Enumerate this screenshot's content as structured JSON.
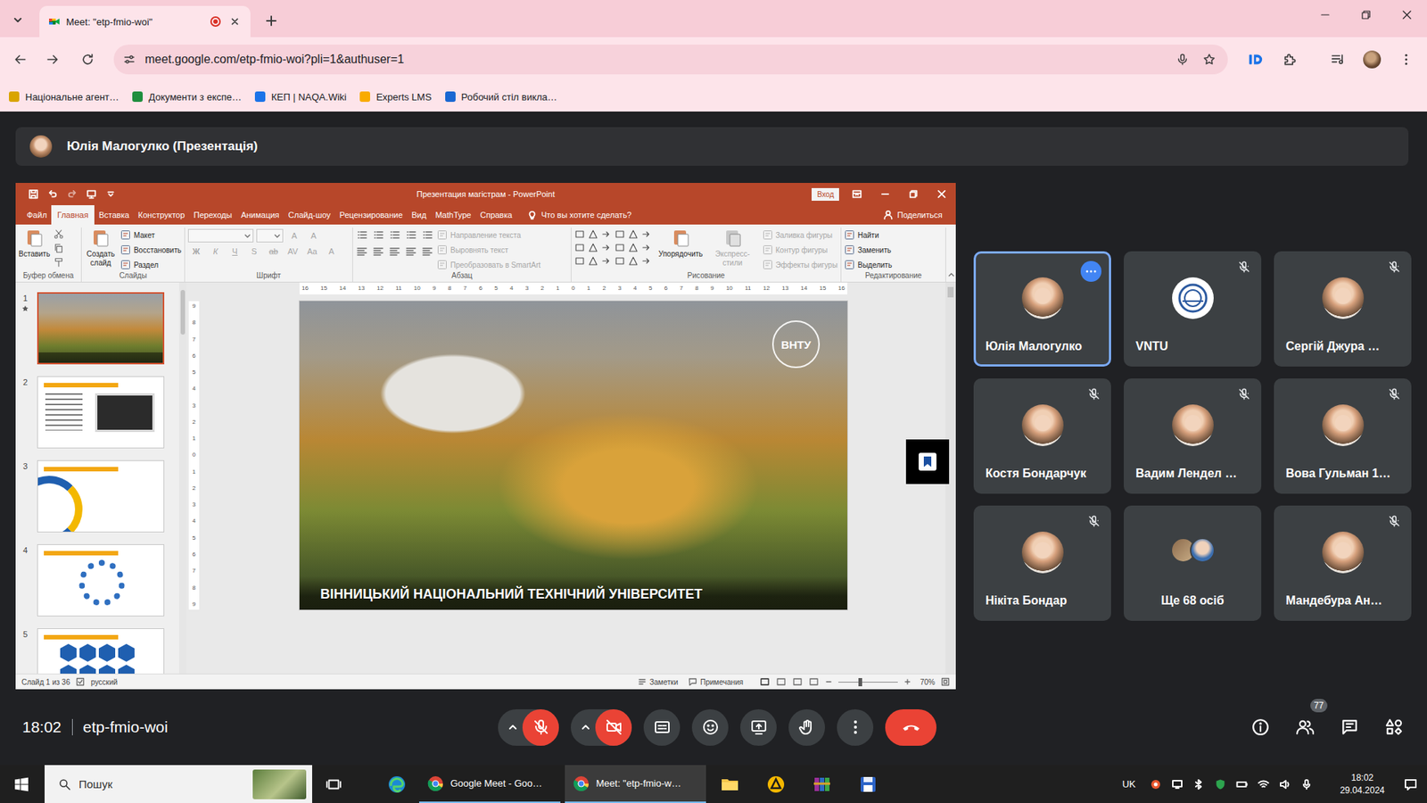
{
  "browser": {
    "tab": {
      "title": "Meet: \"etp-fmio-woi\"",
      "recording": true,
      "selected": true
    },
    "url": "meet.google.com/etp-fmio-woi?pli=1&authuser=1",
    "bookmarks": [
      {
        "label": "Національне агент…",
        "color": "#d9a400"
      },
      {
        "label": "Документи з експе…",
        "color": "#1e8e3e"
      },
      {
        "label": "КЕП | NAQA.Wiki",
        "color": "#1a73e8"
      },
      {
        "label": "Experts LMS",
        "color": "#f9ab00"
      },
      {
        "label": "Робочий стіл викла…",
        "color": "#1967d2"
      }
    ]
  },
  "meet": {
    "presenter": "Юлія Малогулко (Презентація)",
    "time": "18:02",
    "code": "etp-fmio-woi",
    "participants": [
      {
        "name": "Юлія Малогулко",
        "kind": "person",
        "muted": false,
        "highlighted": true,
        "options": true
      },
      {
        "name": "VNTU",
        "kind": "logo",
        "muted": true,
        "highlighted": false,
        "options": false
      },
      {
        "name": "Сергій Джура …",
        "kind": "person",
        "muted": true,
        "highlighted": false,
        "options": false
      },
      {
        "name": "Костя Бондарчук",
        "kind": "person",
        "muted": true,
        "highlighted": false,
        "options": false
      },
      {
        "name": "Вадим Лендел …",
        "kind": "person",
        "muted": true,
        "highlighted": false,
        "options": false
      },
      {
        "name": "Вова Гульман 1…",
        "kind": "person",
        "muted": true,
        "highlighted": false,
        "options": false
      },
      {
        "name": "Нікіта Бондар",
        "kind": "person",
        "muted": true,
        "highlighted": false,
        "options": false
      },
      {
        "name": "Ще 68 осіб",
        "kind": "more",
        "muted": false,
        "highlighted": false,
        "options": false
      },
      {
        "name": "Мандебура Ан…",
        "kind": "person",
        "muted": true,
        "highlighted": false,
        "options": false
      }
    ],
    "controls": [
      {
        "kind": "mic",
        "off": true,
        "menu": true
      },
      {
        "kind": "camera",
        "off": true,
        "menu": true
      },
      {
        "kind": "captions",
        "off": false,
        "menu": false
      },
      {
        "kind": "emoji",
        "off": false,
        "menu": false
      },
      {
        "kind": "present",
        "off": false,
        "menu": false
      },
      {
        "kind": "hand",
        "off": false,
        "menu": false
      },
      {
        "kind": "more",
        "off": false,
        "menu": false
      },
      {
        "kind": "leave",
        "off": false,
        "menu": false
      }
    ],
    "side": [
      {
        "kind": "info",
        "badge": ""
      },
      {
        "kind": "people",
        "badge": "77"
      },
      {
        "kind": "chat",
        "badge": ""
      },
      {
        "kind": "activities",
        "badge": ""
      }
    ]
  },
  "powerpoint": {
    "title": "Презентация магістрам - PowerPoint",
    "signin": "Вход",
    "tabs": [
      {
        "label": "Файл",
        "selected": false
      },
      {
        "label": "Главная",
        "selected": true
      },
      {
        "label": "Вставка",
        "selected": false
      },
      {
        "label": "Конструктор",
        "selected": false
      },
      {
        "label": "Переходы",
        "selected": false
      },
      {
        "label": "Анимация",
        "selected": false
      },
      {
        "label": "Слайд-шоу",
        "selected": false
      },
      {
        "label": "Рецензирование",
        "selected": false
      },
      {
        "label": "Вид",
        "selected": false
      },
      {
        "label": "MathType",
        "selected": false
      },
      {
        "label": "Справка",
        "selected": false
      }
    ],
    "tell": "Что вы хотите сделать?",
    "share": "Поделиться",
    "groups": [
      {
        "label": "Буфер обмена",
        "items": [
          {
            "kind": "large",
            "label": "Вставить",
            "disabled": false
          },
          {
            "kind": "tools",
            "disabled": true
          }
        ]
      },
      {
        "label": "Слайды",
        "items": [
          {
            "kind": "large",
            "label": "Создать слайд",
            "disabled": false
          },
          {
            "kind": "stack",
            "entries": [
              {
                "label": "Макет",
                "disabled": false
              },
              {
                "label": "Восстановить",
                "disabled": false
              },
              {
                "label": "Раздел",
                "disabled": false
              }
            ]
          }
        ]
      },
      {
        "label": "Шрифт",
        "items": [
          {
            "kind": "font",
            "disabled": true,
            "top": [
              "A",
              "A"
            ],
            "bottom": [
              "Ж",
              "К",
              "Ч",
              "S",
              "ab",
              "AV",
              "Aa",
              "A"
            ]
          }
        ]
      },
      {
        "label": "Абзац",
        "items": [
          {
            "kind": "para",
            "disabled": true
          },
          {
            "kind": "stack",
            "entries": [
              {
                "label": "Направление текста",
                "disabled": true
              },
              {
                "label": "Выровнять текст",
                "disabled": true
              },
              {
                "label": "Преобразовать в SmartArt",
                "disabled": true
              }
            ]
          }
        ]
      },
      {
        "label": "Рисование",
        "items": [
          {
            "kind": "shapes",
            "disabled": false
          },
          {
            "kind": "large",
            "label": "Упорядочить",
            "disabled": false
          },
          {
            "kind": "large",
            "label": "Экспресс-стили",
            "disabled": true
          },
          {
            "kind": "stack",
            "entries": [
              {
                "label": "Заливка фигуры",
                "disabled": true
              },
              {
                "label": "Контур фигуры",
                "disabled": true
              },
              {
                "label": "Эффекты фигуры",
                "disabled": true
              }
            ]
          }
        ]
      },
      {
        "label": "Редактирование",
        "items": [
          {
            "kind": "stack",
            "entries": [
              {
                "label": "Найти",
                "disabled": false
              },
              {
                "label": "Заменить",
                "disabled": false
              },
              {
                "label": "Выделить",
                "disabled": false
              }
            ]
          }
        ]
      }
    ],
    "thumbnails": [
      {
        "number": "1",
        "kind": "photo",
        "selected": true,
        "animated": true
      },
      {
        "number": "2",
        "kind": "laptop",
        "selected": false,
        "animated": false
      },
      {
        "number": "3",
        "kind": "arcs",
        "selected": false,
        "animated": false
      },
      {
        "number": "4",
        "kind": "cycle",
        "selected": false,
        "animated": false
      },
      {
        "number": "5",
        "kind": "hexagons",
        "selected": false,
        "animated": false
      }
    ],
    "ruler_h": [
      "16",
      "15",
      "14",
      "13",
      "12",
      "11",
      "10",
      "9",
      "8",
      "7",
      "6",
      "5",
      "4",
      "3",
      "2",
      "1",
      "0",
      "1",
      "2",
      "3",
      "4",
      "5",
      "6",
      "7",
      "8",
      "9",
      "10",
      "11",
      "12",
      "13",
      "14",
      "15",
      "16"
    ],
    "ruler_v": [
      "9",
      "8",
      "7",
      "6",
      "5",
      "4",
      "3",
      "2",
      "1",
      "0",
      "1",
      "2",
      "3",
      "4",
      "5",
      "6",
      "7",
      "8",
      "9"
    ],
    "slide": {
      "caption": "ВІННИЦЬКИЙ НАЦІОНАЛЬНИЙ ТЕХНІЧНИЙ УНІВЕРСИТЕТ",
      "logo": "ВНТУ"
    },
    "status": {
      "slide": "Слайд 1 из 36",
      "language": "русский",
      "notes": "Заметки",
      "comments": "Примечания",
      "zoom": "70%",
      "zoom_level": 0.37
    }
  },
  "taskbar": {
    "search": "Пошук",
    "items": [
      {
        "kind": "taskview",
        "selected": false,
        "open": false
      },
      {
        "kind": "edge",
        "selected": false,
        "open": false
      },
      {
        "kind": "chrome",
        "label": "Google Meet - Goo…",
        "selected": false,
        "open": true
      },
      {
        "kind": "chrome",
        "label": "Meet: \"etp-fmio-w…",
        "selected": true,
        "open": true
      },
      {
        "kind": "explorer",
        "selected": false,
        "open": false
      },
      {
        "kind": "app",
        "selected": false,
        "open": false
      },
      {
        "kind": "winrar",
        "selected": false,
        "open": false
      },
      {
        "kind": "save",
        "selected": false,
        "open": false
      }
    ],
    "lang": "UK",
    "time": "18:02",
    "date": "29.04.2024"
  }
}
